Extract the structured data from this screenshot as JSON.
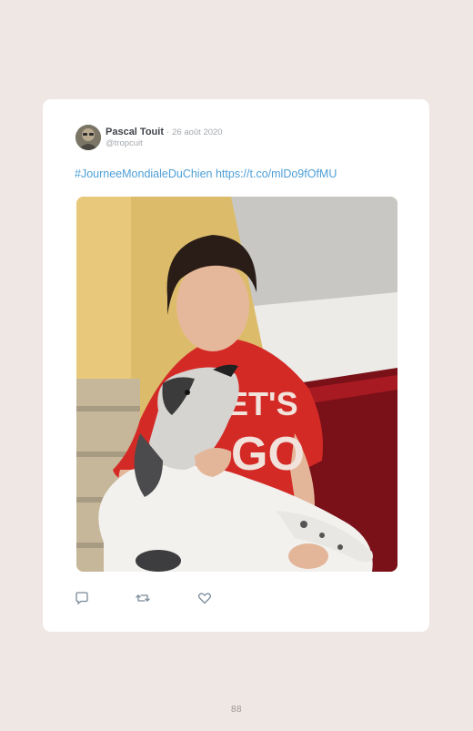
{
  "tweet": {
    "author_name": "Pascal Touit",
    "separator": "·",
    "date": "26 août 2020",
    "handle": "@tropcuit",
    "hashtag": "#JourneeMondialeDuChien",
    "link": "https://t.co/mlDo9fOfMU",
    "media_alt": "Photo: boy in red shirt kissing a blue merle dog on stairs",
    "avatar_icon": "avatar-photo",
    "actions": [
      {
        "name": "reply",
        "icon": "speech-bubble"
      },
      {
        "name": "retweet",
        "icon": "retweet-arrows"
      },
      {
        "name": "like",
        "icon": "heart"
      }
    ]
  },
  "page": {
    "number": "88"
  },
  "colors": {
    "page_background": "#efe7e3",
    "card_background": "#ffffff",
    "link": "#4d9fd6",
    "icon_stroke": "#7a8a99"
  }
}
